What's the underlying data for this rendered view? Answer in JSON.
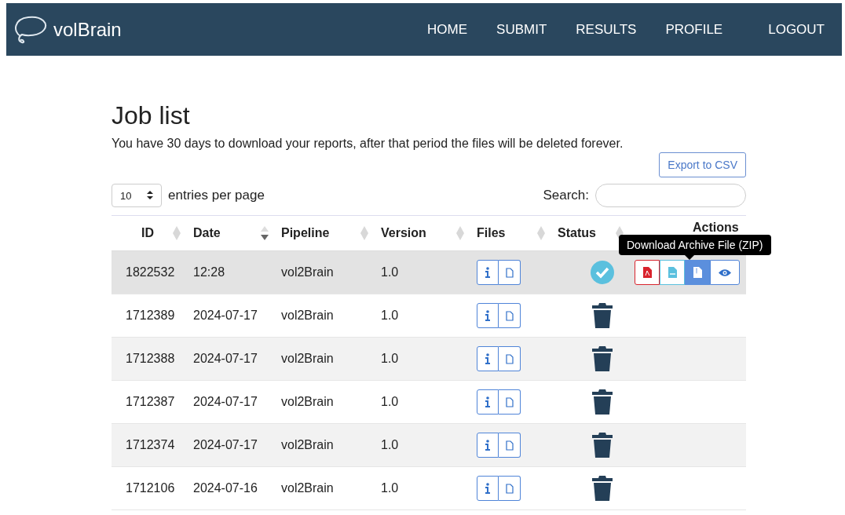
{
  "brand": "volBrain",
  "nav": [
    {
      "label": "HOME"
    },
    {
      "label": "SUBMIT"
    },
    {
      "label": "RESULTS"
    },
    {
      "label": "PROFILE"
    },
    {
      "label": "LOGOUT"
    }
  ],
  "title": "Job list",
  "notice": "You have 30 days to download your reports, after that period the files will be deleted forever.",
  "export_button": "Export to CSV",
  "page_size": {
    "value": "10",
    "label": "entries per page"
  },
  "search": {
    "label": "Search:"
  },
  "columns": [
    {
      "label": "ID",
      "sortable": true,
      "sorted": false
    },
    {
      "label": "Date",
      "sortable": true,
      "sorted": true
    },
    {
      "label": "Pipeline",
      "sortable": true,
      "sorted": false
    },
    {
      "label": "Version",
      "sortable": true,
      "sorted": false
    },
    {
      "label": "Files",
      "sortable": true,
      "sorted": false
    },
    {
      "label": "Status",
      "sortable": true,
      "sorted": false
    },
    {
      "label": "Actions"
    }
  ],
  "rows": [
    {
      "id": "1822532",
      "date": "12:28",
      "pipeline": "vol2Brain",
      "version": "1.0",
      "done": true,
      "hovered": true,
      "actions": true
    },
    {
      "id": "1712389",
      "date": "2024-07-17",
      "pipeline": "vol2Brain",
      "version": "1.0",
      "done": false,
      "hovered": false,
      "actions": false
    },
    {
      "id": "1712388",
      "date": "2024-07-17",
      "pipeline": "vol2Brain",
      "version": "1.0",
      "done": false,
      "hovered": false,
      "actions": false
    },
    {
      "id": "1712387",
      "date": "2024-07-17",
      "pipeline": "vol2Brain",
      "version": "1.0",
      "done": false,
      "hovered": false,
      "actions": false
    },
    {
      "id": "1712374",
      "date": "2024-07-17",
      "pipeline": "vol2Brain",
      "version": "1.0",
      "done": false,
      "hovered": false,
      "actions": false
    },
    {
      "id": "1712106",
      "date": "2024-07-16",
      "pipeline": "vol2Brain",
      "version": "1.0",
      "done": false,
      "hovered": false,
      "actions": false
    }
  ],
  "tooltip": "Download Archive File (ZIP)"
}
